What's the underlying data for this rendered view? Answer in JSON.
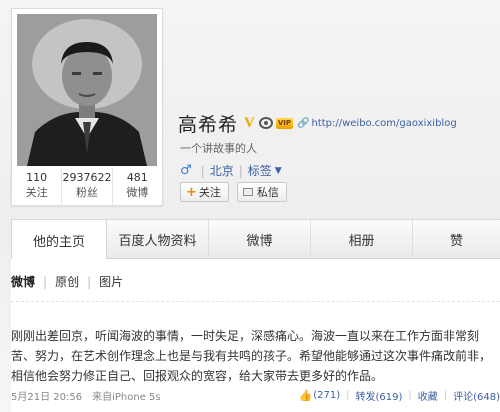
{
  "profile": {
    "name": "高希希",
    "verified_badge": "V",
    "vip_badge": "VIP",
    "blog_url": "http://weibo.com/gaoxixiblog",
    "intro": "一个讲故事的人",
    "gender_icon": "♂",
    "location": "北京",
    "tags_label": "标签",
    "follow_label": "关注",
    "follow_plus": "+",
    "message_label": "私信",
    "stats": [
      {
        "num": "110",
        "label": "关注"
      },
      {
        "num": "2937622",
        "label": "粉丝"
      },
      {
        "num": "481",
        "label": "微博"
      }
    ]
  },
  "tabs": [
    {
      "label": "他的主页",
      "active": true
    },
    {
      "label": "百度人物资料",
      "active": false
    },
    {
      "label": "微博",
      "active": false
    },
    {
      "label": "相册",
      "active": false
    },
    {
      "label": "赞",
      "active": false
    }
  ],
  "filters": [
    "微博",
    "原创",
    "图片"
  ],
  "post": {
    "lines": [
      "刚刚出差回京，听闻海波的事情，一时失足，深感痛心。海波一直以来在工作方面非常刻",
      "苦、努力，在艺术创作理念上也是与我有共鸣的孩子。希望他能够通过这次事件痛改前非，",
      "相信他会努力修正自己、回报观众的宽容，给大家带去更多好的作品。"
    ],
    "time": "5月21日 20:56",
    "source": "来自iPhone 5s",
    "likes": "(271)",
    "repost": "转发(619)",
    "favorite": "收藏",
    "comment": "评论(648)"
  },
  "colors": {
    "link": "#3b5fa5",
    "verified": "#f0a800",
    "accent": "#e88d00"
  }
}
